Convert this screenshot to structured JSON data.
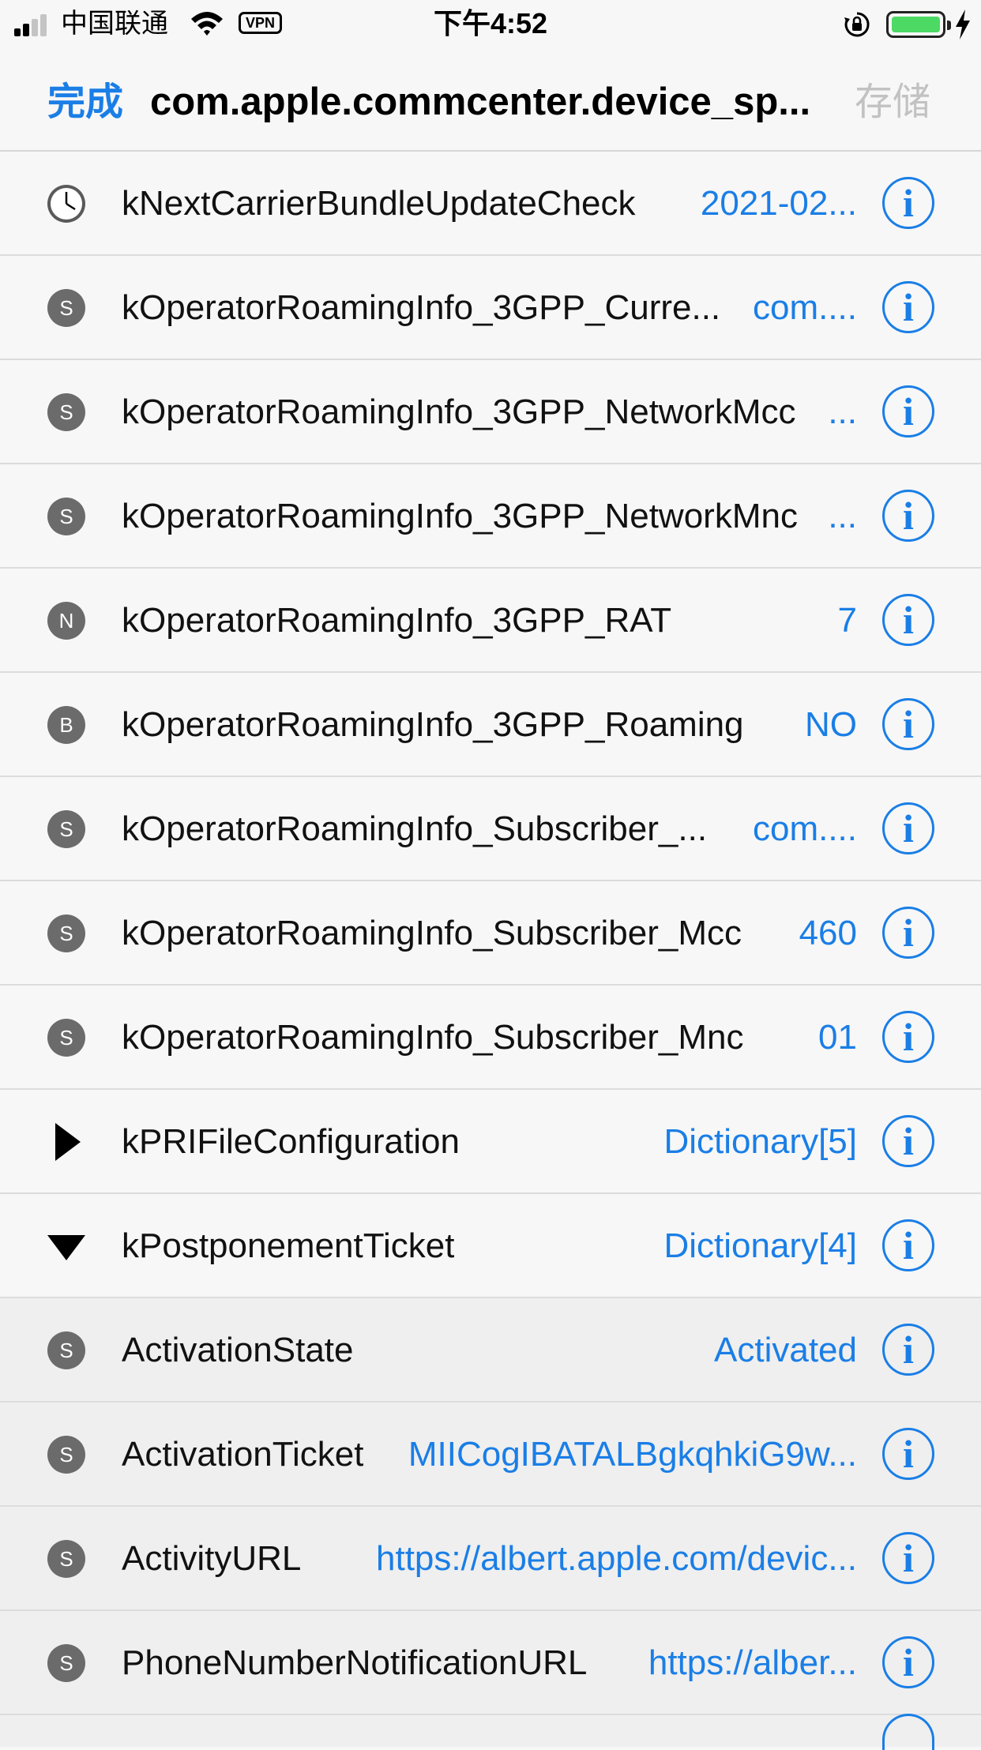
{
  "status_bar": {
    "carrier": "中国联通",
    "vpn": "VPN",
    "time": "下午4:52"
  },
  "navbar": {
    "done_label": "完成",
    "title": "com.apple.commcenter.device_sp...",
    "save_label": "存储"
  },
  "rows": [
    {
      "icon": "clock",
      "key": "kNextCarrierBundleUpdateCheck",
      "value": "2021-02...",
      "key_w": 700,
      "val_w": 240
    },
    {
      "icon": "S",
      "key": "kOperatorRoamingInfo_3GPP_Curre...",
      "value": "com....",
      "key_w": 760,
      "val_w": 150
    },
    {
      "icon": "S",
      "key": "kOperatorRoamingInfo_3GPP_NetworkMcc",
      "value": "...",
      "key_w": 880,
      "val_w": 50
    },
    {
      "icon": "S",
      "key": "kOperatorRoamingInfo_3GPP_NetworkMnc",
      "value": "...",
      "key_w": 880,
      "val_w": 50
    },
    {
      "icon": "N",
      "key": "kOperatorRoamingInfo_3GPP_RAT",
      "value": "7",
      "key_w": 760,
      "val_w": 100
    },
    {
      "icon": "B",
      "key": "kOperatorRoamingInfo_3GPP_Roaming",
      "value": "NO",
      "key_w": 800,
      "val_w": 100
    },
    {
      "icon": "S",
      "key": "kOperatorRoamingInfo_Subscriber_...",
      "value": "com....",
      "key_w": 760,
      "val_w": 150
    },
    {
      "icon": "S",
      "key": "kOperatorRoamingInfo_Subscriber_Mcc",
      "value": "460",
      "key_w": 820,
      "val_w": 100
    },
    {
      "icon": "S",
      "key": "kOperatorRoamingInfo_Subscriber_Mnc",
      "value": "01",
      "key_w": 820,
      "val_w": 80
    },
    {
      "icon": "expand",
      "key": "kPRIFileConfiguration",
      "value": "Dictionary[5]",
      "key_w": 500,
      "val_w": 300
    },
    {
      "icon": "collapse",
      "key": "kPostponementTicket",
      "value": "Dictionary[4]",
      "key_w": 500,
      "val_w": 300
    },
    {
      "icon": "S",
      "child": true,
      "key": "ActivationState",
      "value": "Activated",
      "key_w": 500,
      "val_w": 300
    },
    {
      "icon": "S",
      "child": true,
      "key": "ActivationTicket",
      "value": "MIICogIBATALBgkqhkiG9w...",
      "key_w": 340,
      "val_w": 580
    },
    {
      "icon": "S",
      "child": true,
      "key": "ActivityURL",
      "value": "https://albert.apple.com/devic...",
      "key_w": 260,
      "val_w": 650
    },
    {
      "icon": "S",
      "child": true,
      "key": "PhoneNumberNotificationURL",
      "value": "https://alber...",
      "key_w": 620,
      "val_w": 300
    }
  ],
  "info_label": "i"
}
